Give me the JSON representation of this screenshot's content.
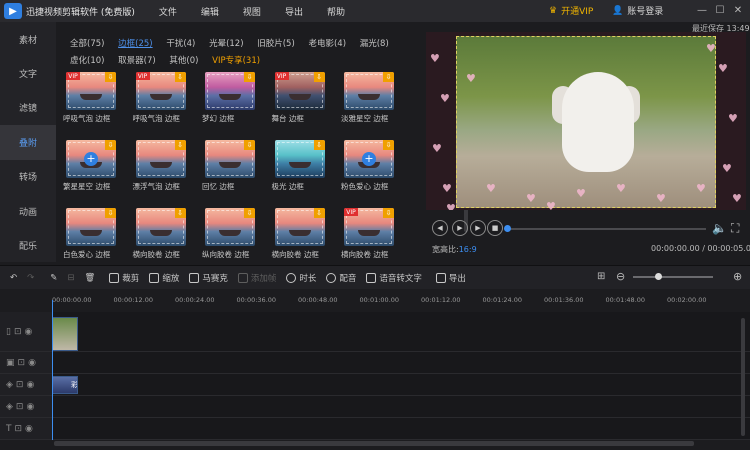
{
  "titlebar": {
    "app_name": "迅捷视频剪辑软件 (免费版)",
    "menus": [
      "文件",
      "编辑",
      "视图",
      "导出",
      "帮助"
    ],
    "vip_label": "开通VIP",
    "account_label": "账号登录",
    "minimize": "—",
    "maximize": "☐",
    "close": "✕"
  },
  "saved_label": "最近保存 13:49",
  "leftnav": [
    "素材",
    "文字",
    "滤镜",
    "叠附",
    "转场",
    "动画",
    "配乐"
  ],
  "library": {
    "categories_row1": [
      "全部(75)",
      "边框(25)",
      "干扰(4)",
      "光晕(12)",
      "旧胶片(5)",
      "老电影(4)",
      "漏光(8)"
    ],
    "categories_row2": [
      "虚化(10)",
      "取景器(7)",
      "其他(0)",
      "VIP专享(31)"
    ],
    "items": [
      {
        "label": "呼吸气泡 边框",
        "vip": true,
        "plus": false
      },
      {
        "label": "呼吸气泡 边框",
        "vip": true,
        "plus": false
      },
      {
        "label": "梦幻 边框",
        "vip": false,
        "plus": false
      },
      {
        "label": "舞台 边框",
        "vip": true,
        "plus": false
      },
      {
        "label": "淡雅星空 边框",
        "vip": false,
        "plus": false
      },
      {
        "label": "繁星星空 边框",
        "vip": false,
        "plus": true
      },
      {
        "label": "漂浮气泡 边框",
        "vip": false,
        "plus": false
      },
      {
        "label": "回忆 边框",
        "vip": false,
        "plus": false
      },
      {
        "label": "极光 边框",
        "vip": false,
        "plus": false
      },
      {
        "label": "粉色爱心 边框",
        "vip": false,
        "plus": true
      },
      {
        "label": "白色爱心 边框",
        "vip": false,
        "plus": false
      },
      {
        "label": "横向胶卷 边框",
        "vip": false,
        "plus": false
      },
      {
        "label": "纵向胶卷 边框",
        "vip": false,
        "plus": false
      },
      {
        "label": "横向胶卷 边框",
        "vip": false,
        "plus": false
      },
      {
        "label": "横向胶卷 边框",
        "vip": true,
        "plus": false
      }
    ]
  },
  "player": {
    "aspect_label": "宽高比:",
    "aspect_value": "16:9",
    "time_display": "00:00:00.00 / 00:00:05.00",
    "progress": 0
  },
  "toolbar": {
    "crop": "裁剪",
    "scale": "缩放",
    "mosaic": "马赛克",
    "add_frame": "添加帧",
    "duration": "时长",
    "dub": "配音",
    "speech_to_text": "语音转文字",
    "export": "导出",
    "zoom_level": 0.3
  },
  "ruler": [
    "00:00:00.00",
    "00:00:12.00",
    "00:00:24.00",
    "00:00:36.00",
    "00:00:48.00",
    "00:01:00.00",
    "00:01:12.00",
    "00:01:24.00",
    "00:01:36.00",
    "00:01:48.00",
    "00:02:00.00"
  ],
  "clips": {
    "text_clip_label": "彩"
  },
  "colors": {
    "accent": "#3d8ef0",
    "vip": "#f0a000",
    "background": "#1c1c1f"
  }
}
